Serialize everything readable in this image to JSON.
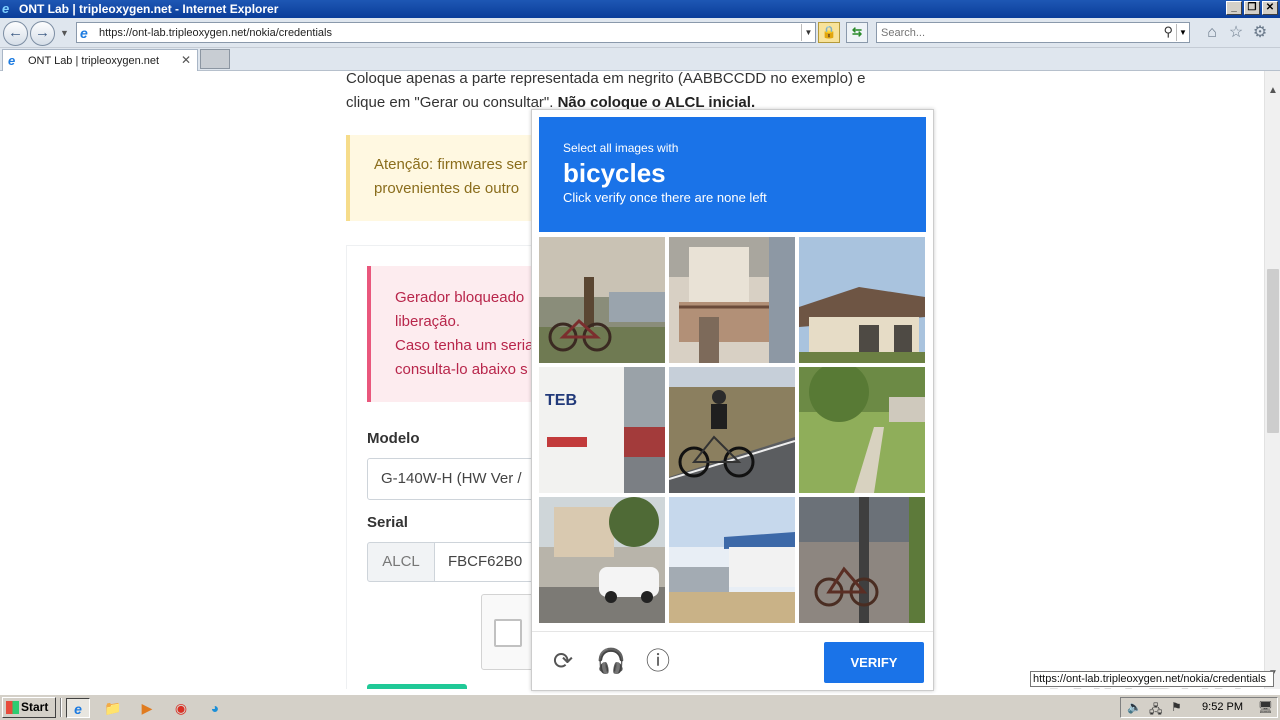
{
  "window": {
    "title": "ONT Lab | tripleoxygen.net - Internet Explorer",
    "minimize": "_",
    "restore": "❐",
    "close": "✕"
  },
  "nav": {
    "url": "https://ont-lab.tripleoxygen.net/nokia/credentials",
    "search_placeholder": "Search..."
  },
  "tabs": [
    {
      "label": "ONT Lab | tripleoxygen.net"
    }
  ],
  "page": {
    "intro_line1": "Coloque apenas a parte representada em negrito (AABBCCDD no exemplo) e",
    "intro_line2_plain": "clique em \"Gerar ou consultar\".",
    "intro_line2_bold": "Não coloque o ALCL inicial.",
    "warning_line1": "Atenção: firmwares ser",
    "warning_line2": "provenientes de outro",
    "danger_line1": "Gerador bloqueado",
    "danger_line2": "liberação.",
    "danger_line3": "Caso tenha um seria",
    "danger_line4": "consulta-lo abaixo s",
    "model_label": "Modelo",
    "model_value": "G-140W-H (HW Ver /",
    "serial_label": "Serial",
    "serial_prefix": "ALCL",
    "serial_value": "FBCF62B0"
  },
  "captcha": {
    "instruction": "Select all images with",
    "target": "bicycles",
    "sub_instruction": "Click verify once there are none left",
    "verify_label": "VERIFY",
    "tiles": [
      {
        "scene": "parked-bicycle-street"
      },
      {
        "scene": "building-balcony"
      },
      {
        "scene": "house-roof"
      },
      {
        "scene": "bus-street"
      },
      {
        "scene": "cyclist-road"
      },
      {
        "scene": "lawn-tree"
      },
      {
        "scene": "street-car-trees"
      },
      {
        "scene": "modern-building"
      },
      {
        "scene": "bicycle-sidewalk"
      }
    ],
    "colors": {
      "header": "#1a73e8",
      "button": "#1a73e8"
    }
  },
  "status": {
    "url_tooltip": "https://ont-lab.tripleoxygen.net/nokia/credentials",
    "watermark": "ANY RUN"
  },
  "taskbar": {
    "start_label": "Start",
    "clock": "9:52 PM"
  }
}
